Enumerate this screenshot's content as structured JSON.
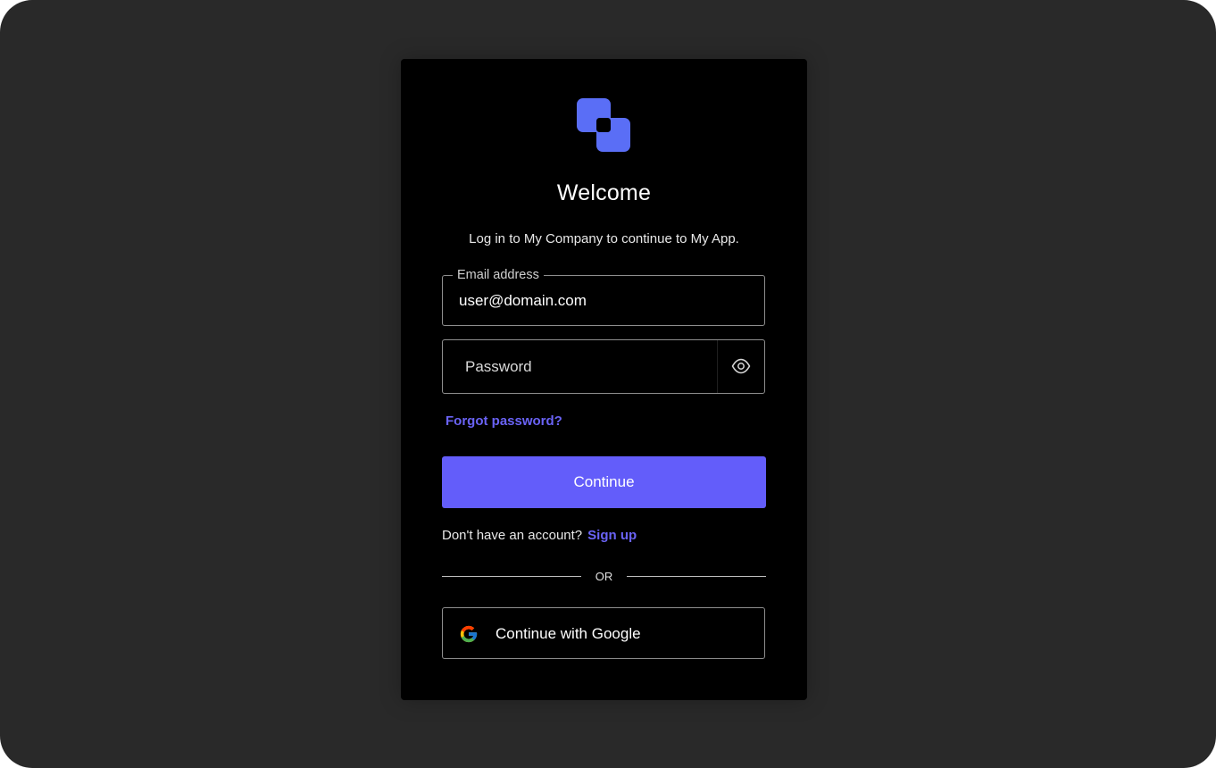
{
  "colors": {
    "background": "#292929",
    "card": "#000000",
    "accent": "#635dfa",
    "link": "#6a63f6",
    "logo": "#5a6ef6"
  },
  "header": {
    "logo_icon": "overlapping-squares-logo",
    "title": "Welcome",
    "subtitle": "Log in to My Company to continue to My App."
  },
  "email": {
    "label": "Email address",
    "value": "user@domain.com"
  },
  "password": {
    "placeholder": "Password",
    "toggle_icon": "eye-icon"
  },
  "links": {
    "forgot_password": "Forgot password?",
    "no_account": "Don't have an account?",
    "sign_up": "Sign up"
  },
  "actions": {
    "continue_label": "Continue",
    "divider_text": "OR",
    "google_label": "Continue with Google",
    "google_icon": "google-icon"
  }
}
